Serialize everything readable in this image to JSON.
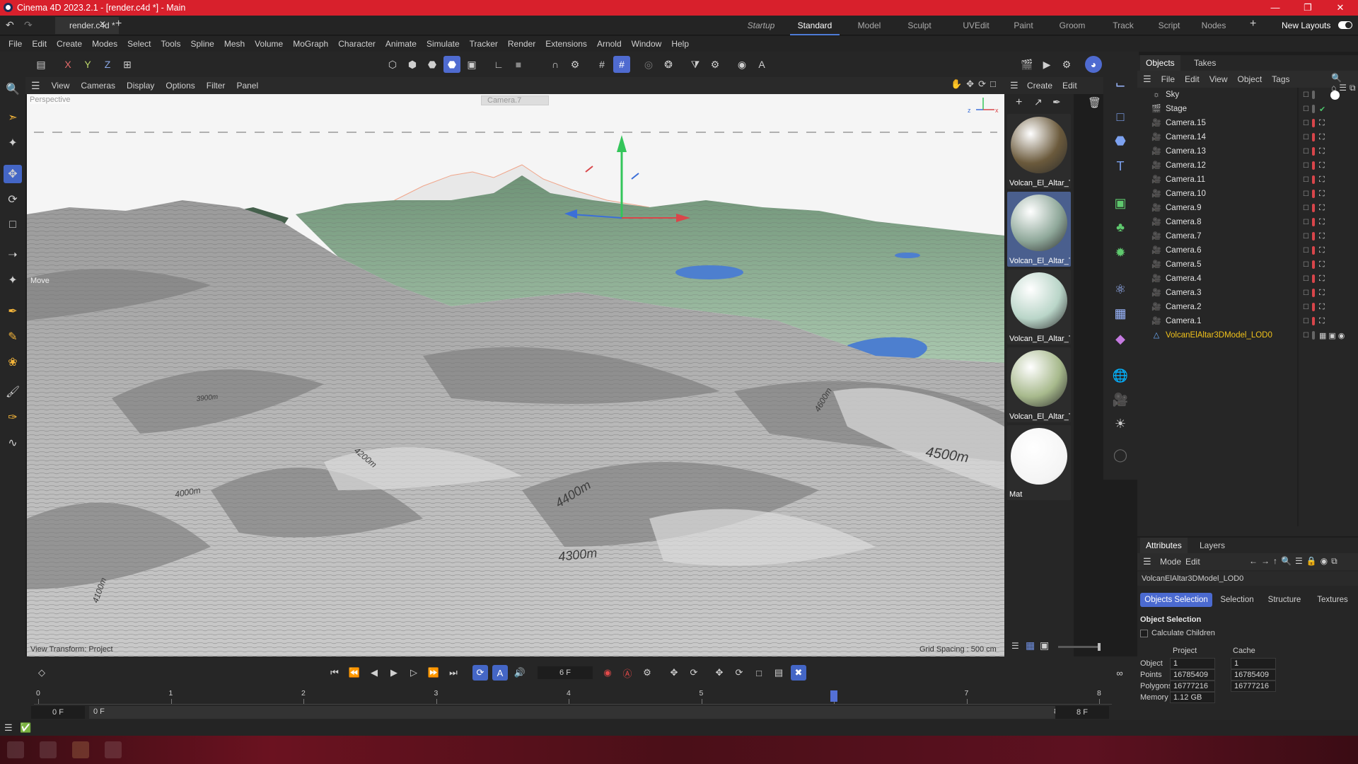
{
  "window": {
    "title": "Cinema 4D 2023.2.1 - [render.c4d *] - Main"
  },
  "doc_tab": "render.c4d *",
  "layouts": {
    "items": [
      "Startup",
      "Standard",
      "Model",
      "Sculpt",
      "UVEdit",
      "Paint",
      "Groom",
      "Track",
      "Script",
      "Nodes"
    ],
    "active": "Standard",
    "new_layouts": "New Layouts"
  },
  "menu": [
    "File",
    "Edit",
    "Create",
    "Modes",
    "Select",
    "Tools",
    "Spline",
    "Mesh",
    "Volume",
    "MoGraph",
    "Character",
    "Animate",
    "Simulate",
    "Tracker",
    "Render",
    "Extensions",
    "Arnold",
    "Window",
    "Help"
  ],
  "axes": {
    "x": "X",
    "y": "Y",
    "z": "Z"
  },
  "viewport_menu": [
    "View",
    "Cameras",
    "Display",
    "Options",
    "Filter",
    "Panel"
  ],
  "viewport": {
    "projection_label": "Perspective",
    "camera_label": "Camera.7",
    "move_label": "Move",
    "view_transform": "View Transform: Project",
    "grid_spacing": "Grid Spacing : 500 cm",
    "contour_labels": [
      "4500m",
      "4400m",
      "4300m",
      "4200m",
      "4000m",
      "3900m",
      "4100m",
      "4600m"
    ]
  },
  "material_panel": {
    "menu": [
      "Create",
      "Edit"
    ],
    "materials": [
      {
        "name": "Volcan_El_Altar_Te",
        "color": "#6b5a3c"
      },
      {
        "name": "Volcan_El_Altar_Te",
        "color": "#8fa89a"
      },
      {
        "name": "Volcan_El_Altar_Te",
        "color": "#b9d5c8"
      },
      {
        "name": "Volcan_El_Altar_Te",
        "color": "#a7b98c"
      },
      {
        "name": "Mat",
        "color": "#ffffff"
      }
    ]
  },
  "objects_manager": {
    "tabs": [
      "Objects",
      "Takes"
    ],
    "menu": [
      "File",
      "Edit",
      "View",
      "Object",
      "Tags"
    ],
    "rows": [
      "Sky",
      "Stage",
      "Camera.15",
      "Camera.14",
      "Camera.13",
      "Camera.12",
      "Camera.11",
      "Camera.10",
      "Camera.9",
      "Camera.8",
      "Camera.7",
      "Camera.6",
      "Camera.5",
      "Camera.4",
      "Camera.3",
      "Camera.2",
      "Camera.1",
      "VolcanElAltar3DModel_LOD0"
    ]
  },
  "attributes": {
    "tabs": [
      "Attributes",
      "Layers"
    ],
    "menu": [
      "Mode",
      "Edit"
    ],
    "object_name": "VolcanElAltar3DModel_LOD0",
    "buttons": [
      "Objects Selection",
      "Selection",
      "Structure",
      "Textures"
    ],
    "section": "Object Selection",
    "calculate_children": "Calculate Children",
    "col_project": "Project",
    "col_cache": "Cache",
    "rows": [
      {
        "label": "Object",
        "project": "1",
        "cache": "1"
      },
      {
        "label": "Points",
        "project": "16785409",
        "cache": "16785409"
      },
      {
        "label": "Polygons",
        "project": "16777216",
        "cache": "16777216"
      },
      {
        "label": "Memory",
        "project": "1.12 GB",
        "cache": ""
      }
    ]
  },
  "timeline": {
    "current_frame": "6 F",
    "start_frame": "0 F",
    "start_frame2": "0 F",
    "end_frame": "8 F",
    "end_frame2": "8 F",
    "ruler": [
      "0",
      "1",
      "2",
      "3",
      "4",
      "5",
      "6",
      "7",
      "8"
    ],
    "playhead": 6
  }
}
